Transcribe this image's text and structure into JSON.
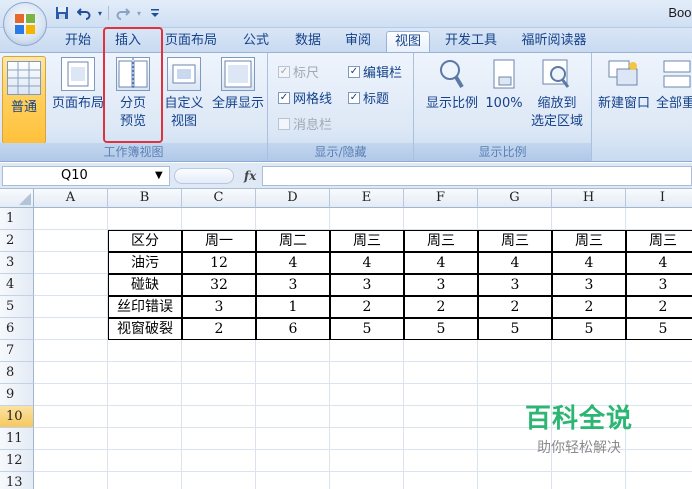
{
  "window": {
    "title": "Book"
  },
  "qat": {
    "save_icon": "save-icon",
    "undo_icon": "undo-icon",
    "redo_icon": "redo-icon",
    "customize_icon": "customize-qat-icon"
  },
  "tabs": [
    {
      "label": "开始"
    },
    {
      "label": "插入"
    },
    {
      "label": "页面布局"
    },
    {
      "label": "公式"
    },
    {
      "label": "数据"
    },
    {
      "label": "审阅"
    },
    {
      "label": "视图"
    },
    {
      "label": "开发工具"
    },
    {
      "label": "福昕阅读器"
    }
  ],
  "active_tab": "视图",
  "ribbon": {
    "workbook_views": {
      "label": "工作簿视图",
      "normal": "普通",
      "page_layout": "页面布局",
      "page_break_line1": "分页",
      "page_break_line2": "预览",
      "custom_line1": "自定义",
      "custom_line2": "视图",
      "fullscreen": "全屏显示"
    },
    "show_hide": {
      "label": "显示/隐藏",
      "ruler": "标尺",
      "formula_bar": "编辑栏",
      "gridlines": "网格线",
      "headings": "标题",
      "message_bar": "消息栏"
    },
    "zoom": {
      "label": "显示比例",
      "zoom": "显示比例",
      "zoom100": "100%",
      "zoom_sel_line1": "缩放到",
      "zoom_sel_line2": "选定区域"
    },
    "window": {
      "new_window": "新建窗口",
      "arrange_all": "全部重"
    }
  },
  "formula_bar": {
    "name_box": "Q10",
    "fx": "fx",
    "value": ""
  },
  "grid": {
    "columns": [
      "A",
      "B",
      "C",
      "D",
      "E",
      "F",
      "G",
      "H",
      "I"
    ],
    "rows": [
      "1",
      "2",
      "3",
      "4",
      "5",
      "6",
      "7",
      "8",
      "9",
      "10",
      "11",
      "12",
      "13"
    ],
    "active_row": "10",
    "table": [
      [
        "区分",
        "周一",
        "周二",
        "周三",
        "周三",
        "周三",
        "周三",
        "周三"
      ],
      [
        "油污",
        "12",
        "4",
        "4",
        "4",
        "4",
        "4",
        "4"
      ],
      [
        "碰缺",
        "32",
        "3",
        "3",
        "3",
        "3",
        "3",
        "3"
      ],
      [
        "丝印错误",
        "3",
        "1",
        "2",
        "2",
        "2",
        "2",
        "2"
      ],
      [
        "视窗破裂",
        "2",
        "6",
        "5",
        "5",
        "5",
        "5",
        "5"
      ]
    ]
  },
  "watermark": {
    "main": "百科全说",
    "sub": "助你轻松解决"
  }
}
